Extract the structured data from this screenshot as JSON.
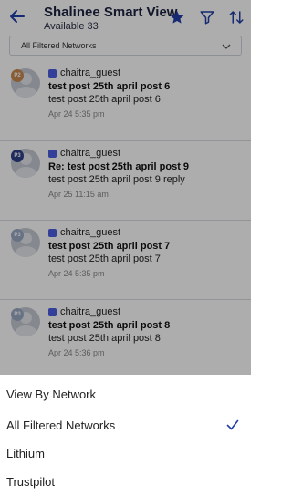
{
  "header": {
    "title": "Shalinee Smart View",
    "subtitle": "Available 33"
  },
  "network_filter": {
    "selected": "All Filtered Networks"
  },
  "posts": [
    {
      "badge": "P2",
      "badge_color": "#c98a4e",
      "author": "chaitra_guest",
      "title": "test post 25th april post 6",
      "body": "test post 25th april post 6",
      "time": "Apr 24 5:35 pm"
    },
    {
      "badge": "P3",
      "badge_color": "#2f3f8a",
      "author": "chaitra_guest",
      "title": "Re: test post 25th april post 9",
      "body": "test post 25th april post 9 reply",
      "time": "Apr 25 11:15 am"
    },
    {
      "badge": "P3",
      "badge_color": "#9aa8c4",
      "author": "chaitra_guest",
      "title": "test post 25th april post 7",
      "body": "test post 25th april post 7",
      "time": "Apr 24 5:35 pm"
    },
    {
      "badge": "P3",
      "badge_color": "#9aa8c4",
      "author": "chaitra_guest",
      "title": "test post 25th april post 8",
      "body": "test post 25th april post 8",
      "time": "Apr 24 5:36 pm"
    }
  ],
  "sheet": {
    "title": "View By Network",
    "options": [
      {
        "label": "All Filtered Networks",
        "selected": true
      },
      {
        "label": "Lithium",
        "selected": false
      },
      {
        "label": "Trustpilot",
        "selected": false
      }
    ]
  },
  "colors": {
    "accent": "#1f3fa8",
    "network_icon": "#4c5ee0"
  }
}
